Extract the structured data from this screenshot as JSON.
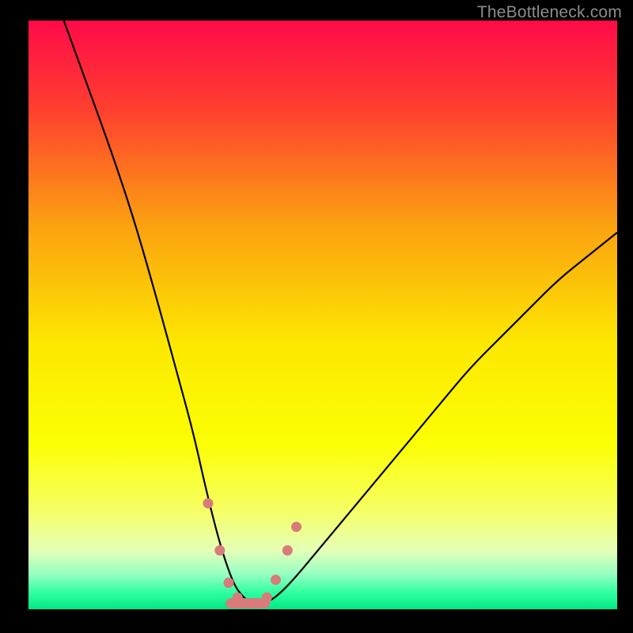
{
  "watermark": "TheBottleneck.com",
  "chart_data": {
    "type": "line",
    "title": "",
    "xlabel": "",
    "ylabel": "",
    "xlim": [
      0,
      100
    ],
    "ylim": [
      0,
      100
    ],
    "grid": false,
    "description": "V-shaped bottleneck curve over a vertical red-to-green background gradient. Lower (greener) values indicate less bottleneck.",
    "background_gradient": [
      {
        "offset": 0.0,
        "color": "#ff0b48"
      },
      {
        "offset": 0.15,
        "color": "#fe3f2f"
      },
      {
        "offset": 0.35,
        "color": "#fca210"
      },
      {
        "offset": 0.55,
        "color": "#fce800"
      },
      {
        "offset": 0.72,
        "color": "#fbff04"
      },
      {
        "offset": 0.83,
        "color": "#f6ff62"
      },
      {
        "offset": 0.9,
        "color": "#e5ffb7"
      },
      {
        "offset": 0.94,
        "color": "#97ffc2"
      },
      {
        "offset": 0.972,
        "color": "#2fff9f"
      },
      {
        "offset": 1.0,
        "color": "#00e884"
      }
    ],
    "series": [
      {
        "name": "bottleneck-curve",
        "color": "#000000",
        "x": [
          6,
          10,
          14,
          18,
          22,
          25,
          28,
          30,
          32,
          33.5,
          35,
          36.5,
          38,
          40,
          42,
          45,
          50,
          55,
          60,
          65,
          70,
          75,
          80,
          85,
          90,
          95,
          100
        ],
        "y": [
          100,
          89,
          78,
          66,
          52,
          41,
          30,
          21,
          13,
          8,
          4,
          2,
          1,
          1,
          2,
          5,
          11,
          17,
          23,
          29,
          35,
          41,
          46,
          51,
          56,
          60,
          64
        ]
      },
      {
        "name": "dotted-valley",
        "type": "scatter",
        "color": "#d77b7b",
        "x": [
          30.5,
          32.5,
          34,
          35.5,
          37,
          38.5,
          40.5,
          42,
          44,
          45.5
        ],
        "y": [
          18,
          10,
          4.5,
          2,
          1,
          1,
          2,
          5,
          10,
          14
        ]
      }
    ],
    "valley_band": {
      "x_range": [
        33.5,
        41
      ],
      "y": 1,
      "color": "#d77b7b"
    }
  }
}
